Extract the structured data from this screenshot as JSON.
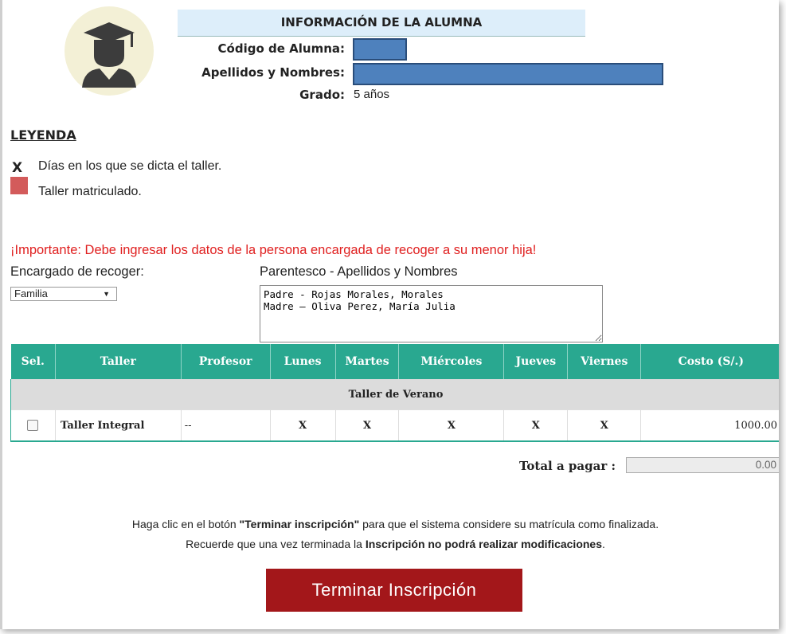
{
  "student_info": {
    "title": "INFORMACIÓN DE LA ALUMNA",
    "code_label": "Código de Alumna:",
    "names_label": "Apellidos y Nombres:",
    "grade_label": "Grado:",
    "grade_value": "5 años"
  },
  "legend": {
    "title": "LEYENDA",
    "x_symbol": "X",
    "days_text": "Días en los que se dicta el taller.",
    "enrolled_text": "Taller matriculado.",
    "enrolled_color": "#d35b5b"
  },
  "pickup": {
    "important_text": "¡Importante: Debe ingresar los datos de la persona encargada de recoger a su menor hija!",
    "responsible_label": "Encargado de recoger:",
    "responsible_value": "Familia",
    "relation_label": "Parentesco - Apellidos y Nombres",
    "relation_text": "Padre - Rojas Morales, Morales\nMadre – Oliva Perez, María Julia"
  },
  "table": {
    "headers": [
      "Sel.",
      "Taller",
      "Profesor",
      "Lunes",
      "Martes",
      "Miércoles",
      "Jueves",
      "Viernes",
      "Costo (S/.)"
    ],
    "group": "Taller de Verano",
    "rows": [
      {
        "taller": "Taller Integral",
        "profesor": "--",
        "lunes": "X",
        "martes": "X",
        "miercoles": "X",
        "jueves": "X",
        "viernes": "X",
        "costo": "1000.00"
      }
    ],
    "header_color": "#29a890"
  },
  "total": {
    "label": "Total a pagar :",
    "value": "0.00"
  },
  "note": {
    "line1_pre": "Haga clic en el botón ",
    "line1_bold": "\"Terminar inscripción\"",
    "line1_post": " para que el sistema considere su matrícula como finalizada.",
    "line2_pre": "Recuerde que una vez terminada la ",
    "line2_bold": "Inscripción no podrá realizar modificaciones",
    "line2_post": "."
  },
  "finish_button": {
    "label": "Terminar Inscripción",
    "color": "#a3171a"
  }
}
